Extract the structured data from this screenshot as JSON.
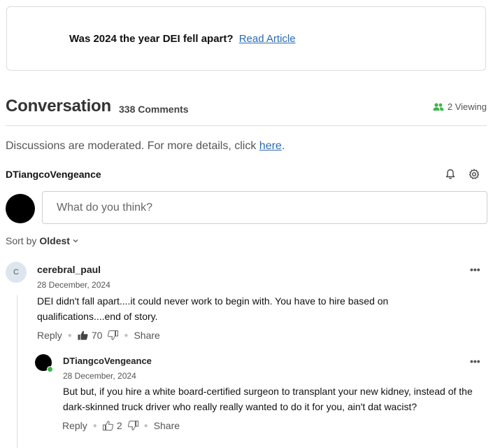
{
  "article": {
    "title": "Was 2024 the year DEI fell apart?",
    "link_label": "Read Article"
  },
  "conversation": {
    "title": "Conversation",
    "count_label": "338 Comments",
    "viewing_label": "2 Viewing"
  },
  "moderation": {
    "text": "Discussions are moderated. For more details, click ",
    "link_label": "here",
    "suffix": "."
  },
  "current_user": {
    "name": "DTiangcoVengeance"
  },
  "composer": {
    "placeholder": "What do you think?"
  },
  "sort": {
    "prefix": "Sort by",
    "value": "Oldest"
  },
  "comments": [
    {
      "avatar_initial": "C",
      "author": "cerebral_paul",
      "date": "28 December, 2024",
      "body": "DEI didn't fall apart....it could never work to begin with. You have to hire based on qualifications....end of story.",
      "reply_label": "Reply",
      "likes": "70",
      "share_label": "Share",
      "more_label": "•••"
    },
    {
      "author": "DTiangcoVengeance",
      "date": "28 December, 2024",
      "body": "But but, if you hire a white board-certified surgeon to transplant your new kidney, instead of the dark-skinned truck driver who really really wanted to do it for you, ain't dat wacist?",
      "reply_label": "Reply",
      "likes": "2",
      "share_label": "Share",
      "more_label": "•••"
    }
  ],
  "colors": {
    "link": "#2a6bb5",
    "online": "#3bb54a",
    "viewing_icon": "#3bb54a"
  }
}
